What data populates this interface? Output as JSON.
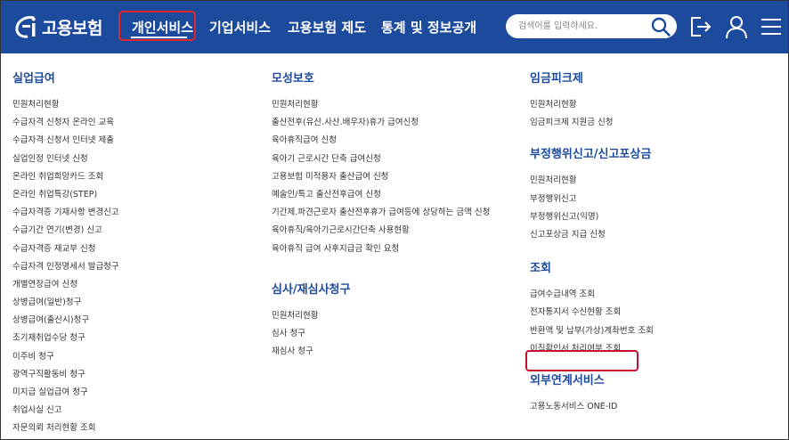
{
  "logo": {
    "text": "고용보험"
  },
  "nav": {
    "items": [
      {
        "label": "개인서비스",
        "active": true
      },
      {
        "label": "기업서비스"
      },
      {
        "label": "고용보험 제도"
      },
      {
        "label": "통계 및 정보공개"
      }
    ]
  },
  "search": {
    "placeholder": "검색어를 입력하세요."
  },
  "header_icons": [
    "search-icon",
    "logout-icon",
    "user-icon",
    "menu-icon"
  ],
  "colors": {
    "header_bg": "#1c4a9c",
    "title": "#1c4a9c",
    "highlight": "#c8102e"
  },
  "columns": [
    {
      "sections": [
        {
          "title": "실업급여",
          "items": [
            "민원처리현황",
            "수급자격 신청자 온라인 교육",
            "수급자격 신청서 인터넷 제출",
            "실업인정 인터넷 신청",
            "온라인 취업희망카드 조회",
            "온라인 취업특강(STEP)",
            "수급자격증 기재사항 변경신고",
            "수급기간 연기(변경) 신고",
            "수급자격증 재교부 신청",
            "수급자격 인정명세서 발급청구",
            "개별연장급여 신청",
            "상병급여(일반)청구",
            "상병급여(출산시)청구",
            "조기재취업수당 청구",
            "이주비 청구",
            "광역구직활동비 청구",
            "미지급 실업급여 청구",
            "취업사실 신고",
            "자문의뢰 처리현황 조회"
          ]
        }
      ]
    },
    {
      "sections": [
        {
          "title": "모성보호",
          "items": [
            "민원처리현황",
            "출산전후(유산.사산.배우자)휴가 급여신청",
            "육아휴직급여 신청",
            "육아기 근로시간 단축 급여신청",
            "고용보험 미적용자 출산급여 신청",
            "예술인/특고 출산전후급여 신청",
            "기간제.파견근로자 출산전후휴가 급여등에 상당하는 금액 신청",
            "육아휴직/육아기근로시간단축 사용현황",
            "육아휴직 급여 사후지급금 확인 요청"
          ]
        },
        {
          "title": "심사/재심사청구",
          "items": [
            "민원처리현황",
            "심사 청구",
            "재심사 청구"
          ]
        }
      ]
    },
    {
      "sections": [
        {
          "title": "임금피크제",
          "items": [
            "민원처리현황",
            "임금피크제 지원금 신청"
          ]
        },
        {
          "title": "부정행위신고/신고포상금",
          "items": [
            "민원처리현황",
            "부정행위신고",
            "부정행위신고(익명)",
            "신고포상금 지급 신청"
          ]
        },
        {
          "title": "조회",
          "items": [
            "급여수급내역 조회",
            "전자통지서 수신현황 조회",
            "반환액 및 납부(가상)계좌번호 조회",
            "이직확인서 처리여부 조회"
          ]
        },
        {
          "title": "외부연계서비스",
          "items": [
            "고용노동서비스 ONE-ID"
          ]
        }
      ]
    }
  ]
}
